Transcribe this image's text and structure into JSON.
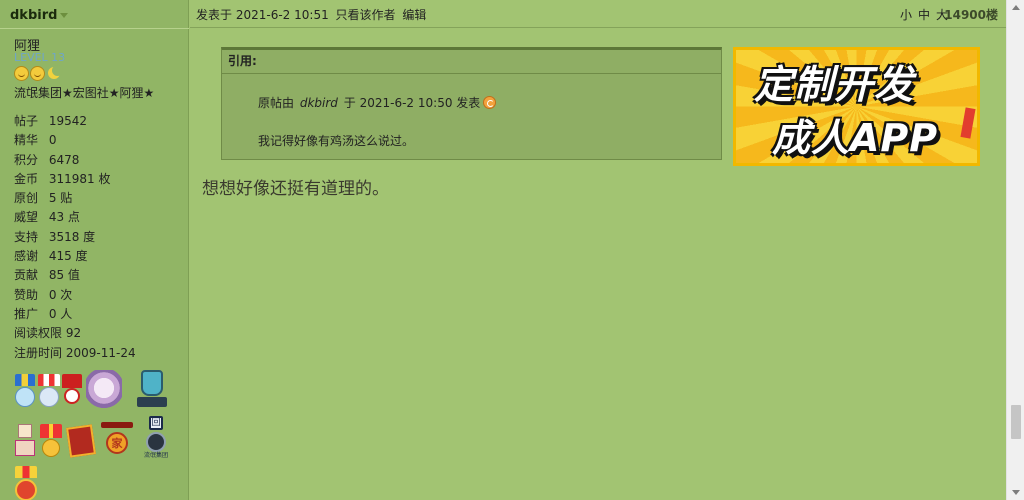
{
  "sidebar": {
    "username": "dkbird",
    "nickname": "阿狸",
    "level": "LEVEL 13",
    "groups": "流氓集团★宏图社★阿狸★",
    "stats": [
      {
        "key": "帖子",
        "value": "19542"
      },
      {
        "key": "精华",
        "value": "0"
      },
      {
        "key": "积分",
        "value": "6478"
      },
      {
        "key": "金币",
        "value": "311981 枚"
      },
      {
        "key": "原创",
        "value": "5 贴"
      },
      {
        "key": "威望",
        "value": "43 点"
      },
      {
        "key": "支持",
        "value": "3518 度"
      },
      {
        "key": "感谢",
        "value": "415 度"
      },
      {
        "key": "贡献",
        "value": "85 值"
      },
      {
        "key": "赞助",
        "value": "0 次"
      },
      {
        "key": "推广",
        "value": "0 人"
      },
      {
        "key": "阅读权限",
        "value": "92"
      },
      {
        "key": "注册时间",
        "value": "2009-11-24"
      }
    ],
    "medal_badge_text": "家",
    "medal_badge_text2": "流氓集团",
    "medal_badge_symbol": "回"
  },
  "post": {
    "posted_label": "发表于",
    "posted_time": "2021-6-2 10:51",
    "only_author": "只看该作者",
    "edit": "编辑",
    "font_small": "小",
    "font_medium": "中",
    "font_large": "大",
    "floor": "14900楼",
    "quote": {
      "title": "引用:",
      "from_prefix": "原帖由",
      "from_author": "dkbird",
      "from_mid": "于",
      "from_time": "2021-6-2 10:50",
      "from_suffix": "发表",
      "text": "我记得好像有鸡汤这么说过。"
    },
    "message": "想想好像还挺有道理的。"
  },
  "ad": {
    "line1": "定制开发",
    "line2": "成人APP"
  },
  "colors": {
    "background": "#a2c472",
    "sidebar": "#91b565",
    "quote_bg": "#8fae64",
    "ad_yellow": "#f7c51e"
  }
}
